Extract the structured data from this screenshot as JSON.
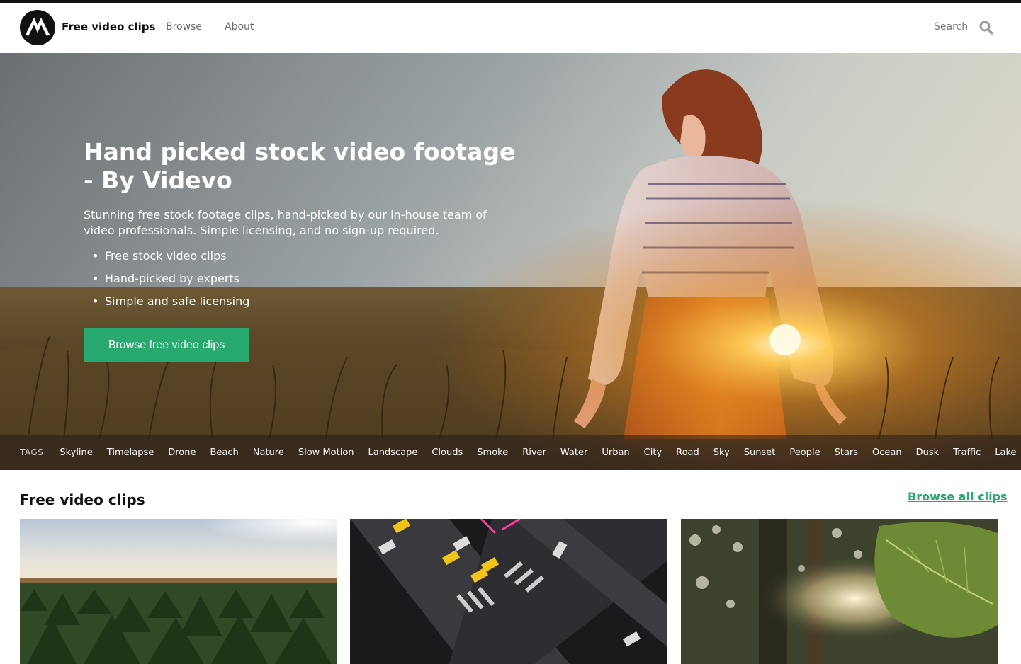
{
  "header": {
    "brand": "Free video clips",
    "nav": [
      {
        "label": "Browse"
      },
      {
        "label": "About"
      }
    ],
    "search_label": "Search"
  },
  "hero": {
    "title": "Hand picked stock video footage - By Videvo",
    "description": "Stunning free stock footage clips, hand-picked by our in-house team of video professionals. Simple licensing, and no sign-up required.",
    "bullets": [
      "Free stock video clips",
      "Hand-picked by experts",
      "Simple and safe licensing"
    ],
    "cta_label": "Browse free video clips"
  },
  "tags": {
    "label": "TAGS",
    "items": [
      "Skyline",
      "Timelapse",
      "Drone",
      "Beach",
      "Nature",
      "Slow Motion",
      "Landscape",
      "Clouds",
      "Smoke",
      "River",
      "Water",
      "Urban",
      "City",
      "Road",
      "Sky",
      "Sunset",
      "People",
      "Stars",
      "Ocean",
      "Dusk",
      "Traffic",
      "Lake"
    ]
  },
  "section": {
    "title": "Free video clips",
    "browse_all_label": "Browse all clips"
  },
  "colors": {
    "accent": "#27a96f",
    "header_text": "#111111",
    "nav_text": "#666666"
  },
  "icons": {
    "logo": "videvo-logo-icon",
    "search": "search-icon"
  }
}
